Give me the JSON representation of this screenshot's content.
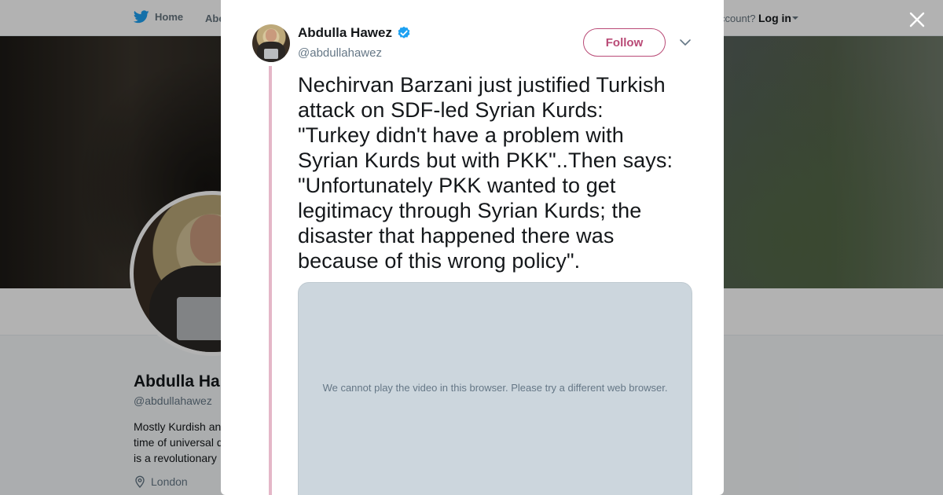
{
  "nav": {
    "home_label": "Home",
    "about_label": "Abo",
    "account_text": "ccount?",
    "login_label": "Log in"
  },
  "profile": {
    "name": "Abdulla Ha",
    "handle": "@abdullahawez",
    "bio_lines": [
      "Mostly Kurdish an",
      "time of universal d",
      "is a revolutionary"
    ],
    "location": "London"
  },
  "tweet": {
    "author_name": "Abdulla Hawez",
    "author_handle": "@abdullahawez",
    "follow_label": "Follow",
    "lines": [
      "Nechirvan Barzani just justified Turkish",
      "attack on SDF-led Syrian Kurds:",
      "\"Turkey didn't have a problem with",
      "Syrian Kurds but with PKK\"..Then says:",
      "\"Unfortunately PKK wanted to get",
      "legitimacy through Syrian Kurds; the",
      "disaster that happened there was",
      "because of this wrong policy\"."
    ],
    "video_message": "We cannot play the video in this browser. Please try a different web browser."
  },
  "colors": {
    "accent": "#b94a76",
    "twitter_blue": "#1da1f2",
    "verified": "#1da1f2",
    "thread_line": "#e4b7c8"
  },
  "icons": {
    "logo": "twitter-bird-icon",
    "verified": "verified-badge-icon",
    "close": "close-icon",
    "caret": "chevron-down-icon",
    "location": "location-pin-icon"
  }
}
